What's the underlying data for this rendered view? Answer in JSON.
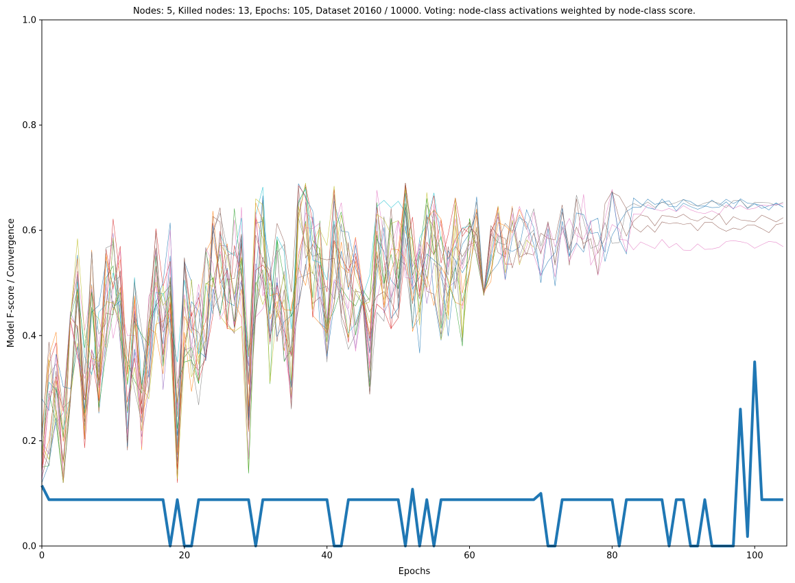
{
  "chart_data": {
    "type": "line",
    "title": "Nodes: 5, Killed nodes: 13, Epochs: 105, Dataset 20160 / 10000.  Voting: node-class activations weighted by node-class score.",
    "xlabel": "Epochs",
    "ylabel": "Model F-score / Convergence",
    "xlim": [
      0,
      104.5
    ],
    "ylim": [
      0.0,
      1.0
    ],
    "x_ticks": [
      0,
      20,
      40,
      60,
      80,
      100
    ],
    "y_ticks": [
      0.0,
      0.2,
      0.4,
      0.6,
      0.8,
      1.0
    ],
    "x_tick_labels": [
      "0",
      "20",
      "40",
      "60",
      "80",
      "100"
    ],
    "y_tick_labels": [
      "0.0",
      "0.2",
      "0.4",
      "0.6",
      "0.8",
      "1.0"
    ],
    "grid": false,
    "legend": "none",
    "convergence_series": {
      "color": "#1f77b4",
      "x": [
        0,
        1,
        2,
        3,
        4,
        5,
        6,
        7,
        8,
        9,
        10,
        11,
        12,
        13,
        14,
        15,
        16,
        17,
        18,
        19,
        20,
        21,
        22,
        23,
        24,
        25,
        26,
        27,
        28,
        29,
        30,
        31,
        32,
        33,
        34,
        35,
        36,
        37,
        38,
        39,
        40,
        41,
        42,
        43,
        44,
        45,
        46,
        47,
        48,
        49,
        50,
        51,
        52,
        53,
        54,
        55,
        56,
        57,
        58,
        59,
        60,
        61,
        62,
        63,
        64,
        65,
        66,
        67,
        68,
        69,
        70,
        71,
        72,
        73,
        74,
        75,
        76,
        77,
        78,
        79,
        80,
        81,
        82,
        83,
        84,
        85,
        86,
        87,
        88,
        89,
        90,
        91,
        92,
        93,
        94,
        95,
        96,
        97,
        98,
        99,
        100,
        101,
        102,
        103,
        104
      ],
      "values": [
        0.115,
        0.088,
        0.088,
        0.088,
        0.088,
        0.088,
        0.088,
        0.088,
        0.088,
        0.088,
        0.088,
        0.088,
        0.088,
        0.088,
        0.088,
        0.088,
        0.088,
        0.088,
        0.0,
        0.088,
        0.0,
        0.0,
        0.088,
        0.088,
        0.088,
        0.088,
        0.088,
        0.088,
        0.088,
        0.088,
        0.0,
        0.088,
        0.088,
        0.088,
        0.088,
        0.088,
        0.088,
        0.088,
        0.088,
        0.088,
        0.088,
        0.0,
        0.0,
        0.088,
        0.088,
        0.088,
        0.088,
        0.088,
        0.088,
        0.088,
        0.088,
        0.0,
        0.108,
        0.0,
        0.088,
        0.0,
        0.088,
        0.088,
        0.088,
        0.088,
        0.088,
        0.088,
        0.088,
        0.088,
        0.088,
        0.088,
        0.088,
        0.088,
        0.088,
        0.088,
        0.1,
        0.0,
        0.0,
        0.088,
        0.088,
        0.088,
        0.088,
        0.088,
        0.088,
        0.088,
        0.088,
        0.0,
        0.088,
        0.088,
        0.088,
        0.088,
        0.088,
        0.088,
        0.0,
        0.088,
        0.088,
        0.0,
        0.0,
        0.088,
        0.0,
        0.0,
        0.0,
        0.0,
        0.26,
        0.018,
        0.35,
        0.088,
        0.088,
        0.088,
        0.088
      ]
    },
    "node_series": [
      {
        "color": "#1f77b4",
        "start": 0.12,
        "end": 0.648,
        "endEpoch": 104,
        "seed": 11
      },
      {
        "color": "#ff7f0e",
        "start": 0.15,
        "end": 0.6,
        "endEpoch": 66,
        "seed": 23
      },
      {
        "color": "#2ca02c",
        "start": 0.18,
        "end": 0.55,
        "endEpoch": 64,
        "seed": 37
      },
      {
        "color": "#d62728",
        "start": 0.14,
        "end": 0.57,
        "endEpoch": 66,
        "seed": 41
      },
      {
        "color": "#9467bd",
        "start": 0.2,
        "end": 0.55,
        "endEpoch": 62,
        "seed": 53
      },
      {
        "color": "#8c564b",
        "start": 0.13,
        "end": 0.605,
        "endEpoch": 104,
        "seed": 67
      },
      {
        "color": "#e377c2",
        "start": 0.16,
        "end": 0.573,
        "endEpoch": 104,
        "seed": 71
      },
      {
        "color": "#7f7f7f",
        "start": 0.17,
        "end": 0.648,
        "endEpoch": 104,
        "seed": 83
      },
      {
        "color": "#bcbd22",
        "start": 0.19,
        "end": 0.62,
        "endEpoch": 69,
        "seed": 97
      },
      {
        "color": "#17becf",
        "start": 0.21,
        "end": 0.45,
        "endEpoch": 63,
        "seed": 103
      },
      {
        "color": "#1f77b4",
        "start": 0.28,
        "end": 0.65,
        "endEpoch": 104,
        "seed": 109
      },
      {
        "color": "#ff7f0e",
        "start": 0.22,
        "end": 0.6,
        "endEpoch": 68,
        "seed": 127
      },
      {
        "color": "#2ca02c",
        "start": 0.15,
        "end": 0.56,
        "endEpoch": 62,
        "seed": 131
      },
      {
        "color": "#d62728",
        "start": 0.14,
        "end": 0.58,
        "endEpoch": 64,
        "seed": 137
      },
      {
        "color": "#e377c2",
        "start": 0.12,
        "end": 0.64,
        "endEpoch": 104,
        "seed": 149
      },
      {
        "color": "#8c564b",
        "start": 0.2,
        "end": 0.62,
        "endEpoch": 104,
        "seed": 151
      },
      {
        "color": "#7f7f7f",
        "start": 0.18,
        "end": 0.61,
        "endEpoch": 69,
        "seed": 163
      },
      {
        "color": "#bcbd22",
        "start": 0.16,
        "end": 0.6,
        "endEpoch": 62,
        "seed": 173
      }
    ]
  }
}
